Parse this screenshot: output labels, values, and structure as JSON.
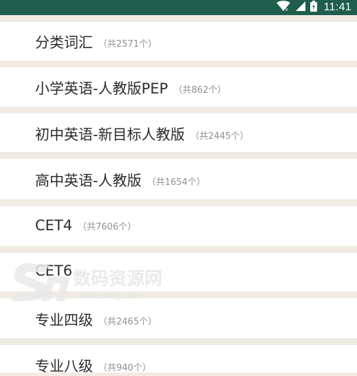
{
  "status_bar": {
    "time": "11:41",
    "background": "#1f5e4c"
  },
  "list": {
    "items": [
      {
        "title": "分类词汇",
        "count": "（共2571个）"
      },
      {
        "title": "小学英语-人教版PEP",
        "count": "（共862个）"
      },
      {
        "title": "初中英语-新目标人教版",
        "count": "（共2445个）"
      },
      {
        "title": "高中英语-人教版",
        "count": "（共1654个）"
      },
      {
        "title": "CET4",
        "count": "（共7606个）"
      },
      {
        "title": "CET6",
        "count": ""
      },
      {
        "title": "专业四级",
        "count": "（共2465个）"
      },
      {
        "title": "专业八级",
        "count": "（共940个）"
      }
    ]
  },
  "watermark": {
    "brand": "数码资源网",
    "url": "www.smzy.com"
  }
}
